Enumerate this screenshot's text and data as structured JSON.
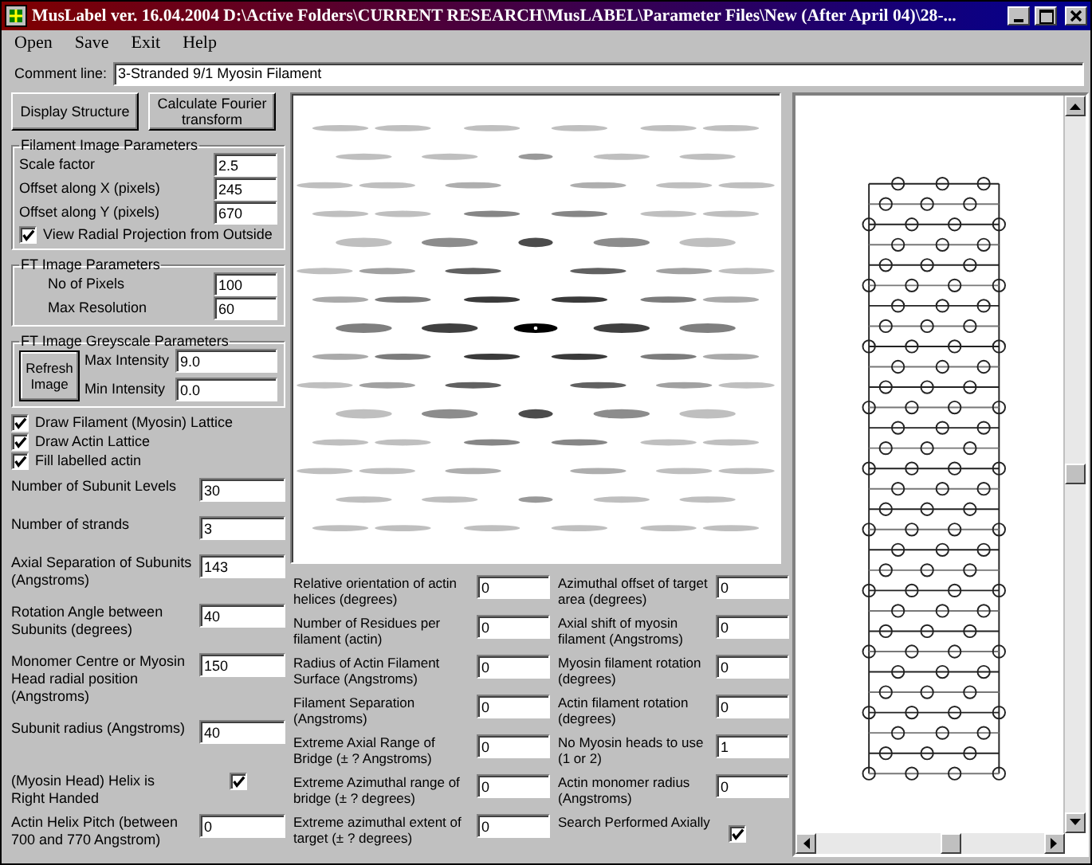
{
  "window": {
    "title": "MusLabel ver. 16.04.2004  D:\\Active Folders\\CURRENT RESEARCH\\MusLABEL\\Parameter Files\\New (After April 04)\\28-..."
  },
  "menu": [
    "Open",
    "Save",
    "Exit",
    "Help"
  ],
  "comment": {
    "label": "Comment line:",
    "value": "3-Stranded 9/1 Myosin Filament"
  },
  "buttons": [
    "Display Structure",
    "Calculate  Fourier transform"
  ],
  "filament_image": {
    "title": "Filament Image Parameters",
    "fields": [
      {
        "label": "Scale factor",
        "value": "2.5"
      },
      {
        "label": "Offset along X (pixels)",
        "value": "245"
      },
      {
        "label": "Offset along Y (pixels)",
        "value": "670"
      }
    ],
    "radial_projection": {
      "label": "View Radial Projection from Outside",
      "checked": true
    }
  },
  "ft_image": {
    "title": "FT Image Parameters",
    "fields": [
      {
        "label": "No of Pixels",
        "value": "100"
      },
      {
        "label": "Max Resolution",
        "value": "60"
      }
    ]
  },
  "greyscale": {
    "title": "FT Image Greyscale Parameters",
    "refresh_button": "Refresh Image",
    "fields": [
      {
        "label": "Max Intensity",
        "value": "9.0"
      },
      {
        "label": "Min Intensity",
        "value": "0.0"
      }
    ]
  },
  "checkboxes": [
    {
      "label": "Draw Filament (Myosin) Lattice",
      "checked": true
    },
    {
      "label": "Draw Actin Lattice",
      "checked": true
    },
    {
      "label": "Fill labelled actin",
      "checked": true
    }
  ],
  "left_fields": [
    {
      "label": "Number of Subunit Levels",
      "value": "30"
    },
    {
      "label": "Number of strands",
      "value": "3"
    },
    {
      "label": "Axial Separation of Subunits (Angstroms)",
      "value": "143"
    },
    {
      "label": "Rotation Angle between Subunits (degrees)",
      "value": "40"
    },
    {
      "label": "Monomer Centre or Myosin Head radial position (Angstroms)",
      "value": "150"
    },
    {
      "label": "Subunit radius (Angstroms)",
      "value": "40"
    }
  ],
  "right_handed": {
    "label": "(Myosin Head) Helix is Right Handed",
    "checked": true
  },
  "actin_pitch": {
    "label": "Actin Helix Pitch (between 700 and 770 Angstrom)",
    "value": "0"
  },
  "params_left": [
    {
      "label": "Relative orientation of actin helices (degrees)",
      "value": "0"
    },
    {
      "label": "Number of Residues per filament (actin)",
      "value": "0"
    },
    {
      "label": "Radius of Actin Filament Surface (Angstroms)",
      "value": "0"
    },
    {
      "label": "Filament Separation (Angstroms)",
      "value": "0"
    },
    {
      "label": "Extreme Axial Range of Bridge (± ? Angstroms)",
      "value": "0"
    },
    {
      "label": "Extreme Azimuthal range of bridge (± ? degrees)",
      "value": "0"
    },
    {
      "label": "Extreme azimuthal extent of target (± ?  degrees)",
      "value": "0"
    }
  ],
  "params_right": [
    {
      "label": "Azimuthal offset of target area (degrees)",
      "value": "0"
    },
    {
      "label": "Axial shift of myosin filament (Angstroms)",
      "value": "0"
    },
    {
      "label": "Myosin filament rotation (degrees)",
      "value": "0"
    },
    {
      "label": "Actin filament rotation (degrees)",
      "value": "0"
    },
    {
      "label": "No Myosin heads to use (1 or 2)",
      "value": "1"
    },
    {
      "label": "Actin monomer radius (Angstroms)",
      "value": "0"
    }
  ],
  "search_axially": {
    "label": "Search Performed Axially",
    "checked": true
  }
}
